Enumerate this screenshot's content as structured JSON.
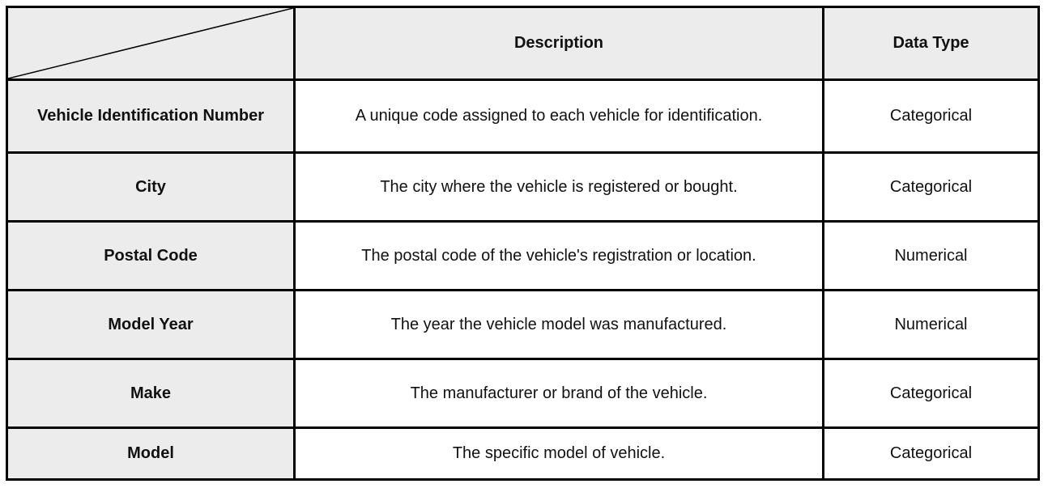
{
  "table": {
    "headers": [
      "",
      "Description",
      "Data Type"
    ],
    "rows": [
      {
        "field": "Vehicle Identification Number",
        "description": "A unique code assigned to each vehicle for identification.",
        "type": "Categorical"
      },
      {
        "field": "City",
        "description": "The city where the vehicle is registered or bought.",
        "type": "Categorical"
      },
      {
        "field": "Postal Code",
        "description": "The postal code of the vehicle's registration or location.",
        "type": "Numerical"
      },
      {
        "field": "Model Year",
        "description": "The year the vehicle model was manufactured.",
        "type": "Numerical"
      },
      {
        "field": "Make",
        "description": "The manufacturer or brand of the vehicle.",
        "type": "Categorical"
      },
      {
        "field": "Model",
        "description": "The specific model of vehicle.",
        "type": "Categorical"
      }
    ]
  },
  "colors": {
    "header_bg": "#ececec",
    "border": "#000000"
  }
}
